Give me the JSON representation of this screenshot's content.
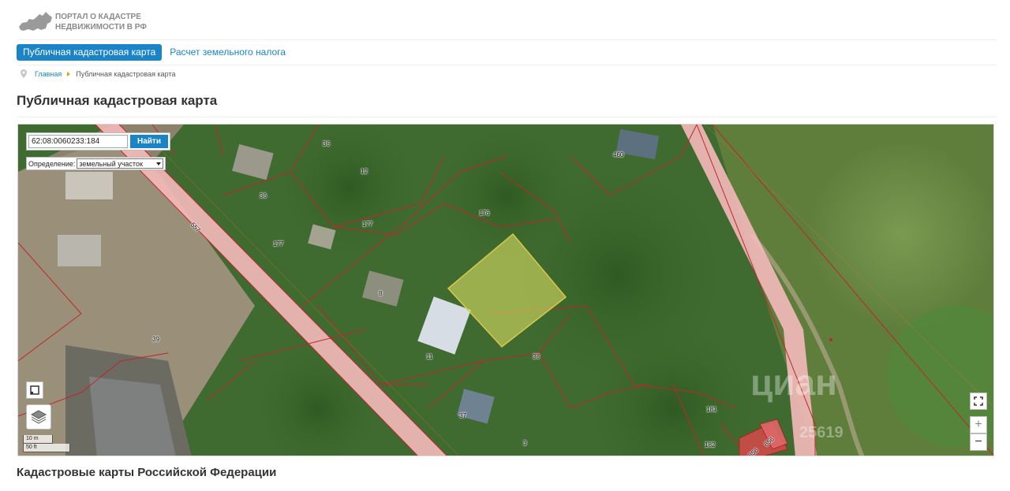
{
  "header": {
    "logo_text": "ПОРТАЛ О КАДАСТРЕ\nНЕДВИЖИМОСТИ В РФ"
  },
  "nav": {
    "tabs": [
      {
        "label": "Публичная кадастровая карта",
        "active": true
      },
      {
        "label": "Расчет земельного налога",
        "active": false
      }
    ]
  },
  "breadcrumb": {
    "home": "Главная",
    "current": "Публичная кадастровая карта"
  },
  "page_title": "Публичная кадастровая карта",
  "map": {
    "search": {
      "value": "62:08:0060233:184",
      "button": "Найти"
    },
    "definition": {
      "label": "Определение:",
      "selected": "земельный участок"
    },
    "scale": {
      "metric": "10 m",
      "imperial": "50 ft"
    },
    "watermark": {
      "brand": "циан",
      "id": "25619"
    },
    "zoom": {
      "plus": "+",
      "minus": "−"
    },
    "parcel_labels": [
      "36",
      "12",
      "36",
      "460",
      "176",
      "177",
      "557",
      "177",
      "8",
      "39",
      "11",
      "38",
      "37",
      "3",
      "181",
      "182",
      "856",
      "856",
      "78"
    ],
    "colors": {
      "accent": "#1a84c7",
      "parcel_border": "#c0262d",
      "road": "#f2b8b8",
      "selected_parcel": "#e8e86a"
    }
  },
  "footer_title": "Кадастровые карты Российской Федерации"
}
